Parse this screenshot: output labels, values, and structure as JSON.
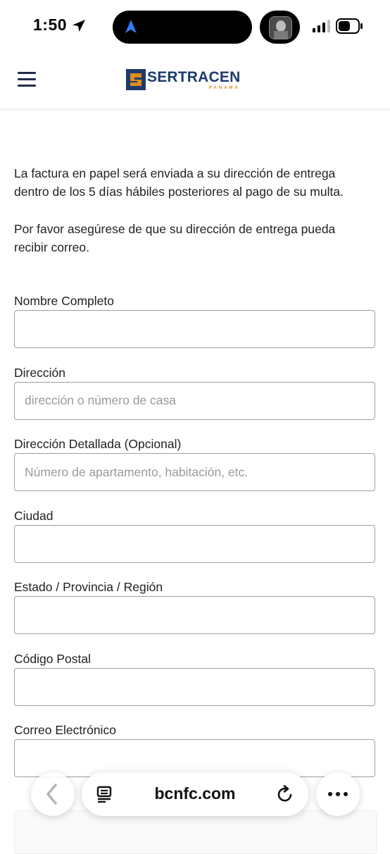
{
  "status_bar": {
    "time": "1:50"
  },
  "header": {
    "logo_text": "SERTRACEN",
    "logo_sub": "PANAMA",
    "brand_blue": "#1d3a6b",
    "brand_orange": "#e08a1e"
  },
  "intro": {
    "paragraph1": "La factura en papel será enviada a su dirección de entrega dentro de los 5 días hábiles posteriores al pago de su multa.",
    "paragraph2": "Por favor asegúrese de que su dirección de entrega pueda recibir correo."
  },
  "form": {
    "fields": [
      {
        "label": "Nombre Completo",
        "value": "",
        "placeholder": ""
      },
      {
        "label": "Dirección",
        "value": "",
        "placeholder": "dirección o número de casa"
      },
      {
        "label": "Dirección Detallada (Opcional)",
        "value": "",
        "placeholder": "Número de apartamento, habitación, etc."
      },
      {
        "label": "Ciudad",
        "value": "",
        "placeholder": ""
      },
      {
        "label": "Estado / Provincia / Región",
        "value": "",
        "placeholder": ""
      },
      {
        "label": "Código Postal",
        "value": "",
        "placeholder": ""
      },
      {
        "label": "Correo Electrónico",
        "value": "",
        "placeholder": ""
      }
    ]
  },
  "browser": {
    "url": "bcnfc.com",
    "icons": [
      "back-icon",
      "reader-icon",
      "reload-icon",
      "more-icon"
    ]
  }
}
